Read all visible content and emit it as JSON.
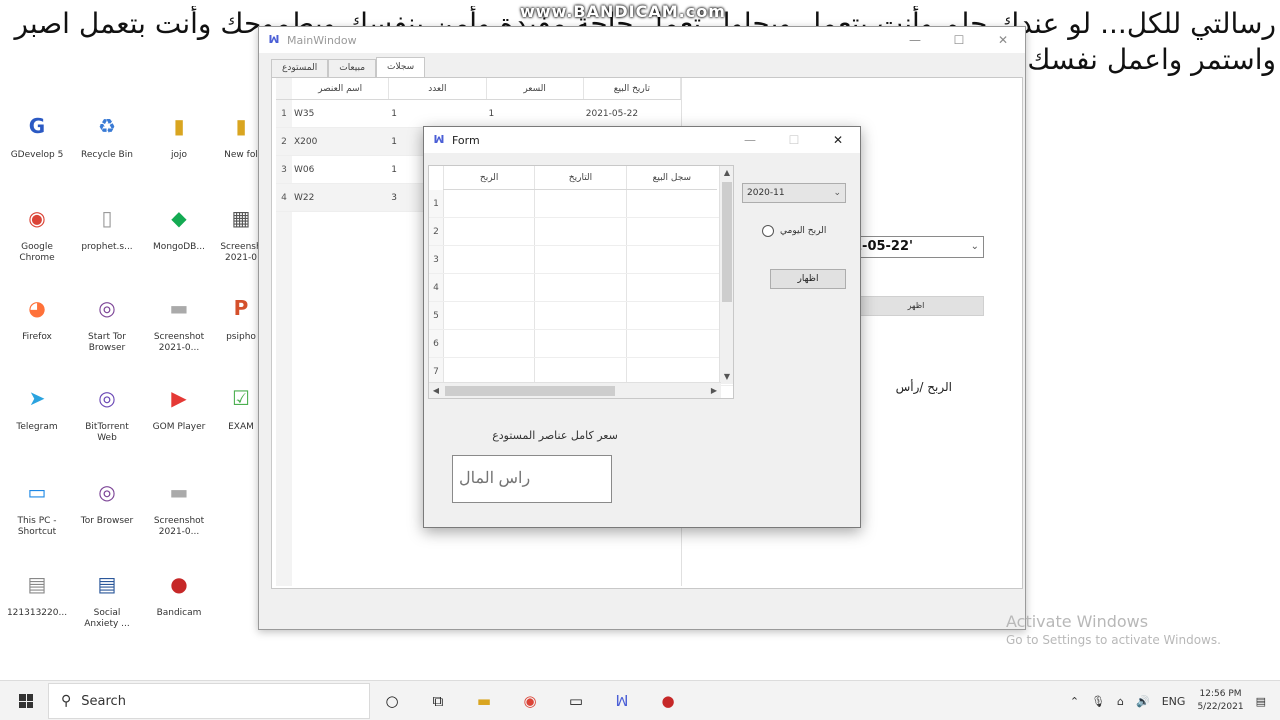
{
  "overlay": {
    "marquee_text": "رسالتي للكل... لو عندك حلم وأنت بتعمل ويحاول تعمل حاجة مفيدة وأمن بنفسك وبطموحك وأنت بتعمل اصبر واستمر واعمل نفسك اصبر وتشتغل",
    "watermark": "www.BANDICAM.com"
  },
  "desktop": {
    "icons": [
      {
        "name": "gdevelop",
        "label": "GDevelop 5",
        "glyph": "G",
        "color": "#2b59c3"
      },
      {
        "name": "recycle-bin",
        "label": "Recycle Bin",
        "glyph": "♻",
        "color": "#3a7bd5"
      },
      {
        "name": "folder-jojo",
        "label": "jojo",
        "glyph": "▮",
        "color": "#d9a520"
      },
      {
        "name": "folder-new",
        "label": "New fol",
        "glyph": "▮",
        "color": "#d9a520"
      },
      {
        "name": "chrome",
        "label": "Google\nChrome",
        "glyph": "◉",
        "color": "#db4437"
      },
      {
        "name": "file-prophet",
        "label": "prophet.s...",
        "glyph": "▯",
        "color": "#9a9a9a"
      },
      {
        "name": "mongodb",
        "label": "MongoDB...",
        "glyph": "◆",
        "color": "#13aa52"
      },
      {
        "name": "screenshot-1",
        "label": "Screensh\n2021-0",
        "glyph": "▦",
        "color": "#555555"
      },
      {
        "name": "firefox",
        "label": "Firefox",
        "glyph": "◕",
        "color": "#ff7139"
      },
      {
        "name": "tor-browser",
        "label": "Start Tor\nBrowser",
        "glyph": "◎",
        "color": "#7e4798"
      },
      {
        "name": "screenshot-2",
        "label": "Screenshot\n2021-0...",
        "glyph": "▬",
        "color": "#aaaaaa"
      },
      {
        "name": "psiphon",
        "label": "psipho",
        "glyph": "P",
        "color": "#d4502b"
      },
      {
        "name": "telegram",
        "label": "Telegram",
        "glyph": "➤",
        "color": "#2aa3df"
      },
      {
        "name": "bittorrent",
        "label": "BitTorrent\nWeb",
        "glyph": "◎",
        "color": "#6c4ab6"
      },
      {
        "name": "gom-player",
        "label": "GOM Player",
        "glyph": "▶",
        "color": "#e53935"
      },
      {
        "name": "exam-file",
        "label": "EXAM",
        "glyph": "☑",
        "color": "#4caf50"
      },
      {
        "name": "this-pc",
        "label": "This PC -\nShortcut",
        "glyph": "▭",
        "color": "#1e88e5"
      },
      {
        "name": "tor-folder",
        "label": "Tor Browser",
        "glyph": "◎",
        "color": "#7e4798"
      },
      {
        "name": "screenshot-3",
        "label": "Screenshot\n2021-0...",
        "glyph": "▬",
        "color": "#aaaaaa"
      },
      {
        "name": "doc-file",
        "label": "121313220...",
        "glyph": "▤",
        "color": "#888888"
      },
      {
        "name": "social-anxiety",
        "label": "Social\nAnxiety ...",
        "glyph": "▤",
        "color": "#2b579a"
      },
      {
        "name": "bandicam",
        "label": "Bandicam",
        "glyph": "●",
        "color": "#c62828"
      }
    ]
  },
  "main_window": {
    "title": "MainWindow",
    "tabs": [
      "سجلات",
      "مبيعات",
      "المستودع"
    ],
    "active_tab": 0,
    "table": {
      "headers": [
        "اسم العنصر",
        "العدد",
        "السعر",
        "تاريخ البيع"
      ],
      "rows": [
        {
          "n": "1",
          "cells": [
            "W35",
            "1",
            "1",
            "2021-05-22"
          ]
        },
        {
          "n": "2",
          "cells": [
            "X200",
            "1",
            "",
            ""
          ]
        },
        {
          "n": "3",
          "cells": [
            "W06",
            "1",
            "",
            ""
          ]
        },
        {
          "n": "4",
          "cells": [
            "W22",
            "3",
            "",
            ""
          ]
        }
      ]
    },
    "date_combo": "1-05-22'",
    "show_label": "اظهر",
    "profit_capital_label": "الربح /رأس"
  },
  "form_window": {
    "title": "Form",
    "table": {
      "headers": [
        "الربح",
        "التاريخ",
        "سجل البيع"
      ],
      "row_numbers": [
        "1",
        "2",
        "3",
        "4",
        "5",
        "6",
        "7"
      ]
    },
    "month_combo": "2020-11",
    "daily_profit_label": "الربح اليومي",
    "show_label": "اظهار",
    "stock_label": "سعر كامل عناصر المستودع",
    "capital_placeholder": "راس المال"
  },
  "activation": {
    "title": "Activate Windows",
    "subtitle": "Go to Settings to activate Windows."
  },
  "taskbar": {
    "search_placeholder": "Search",
    "lang": "ENG",
    "time": "12:56 PM",
    "date": "5/22/2021"
  }
}
